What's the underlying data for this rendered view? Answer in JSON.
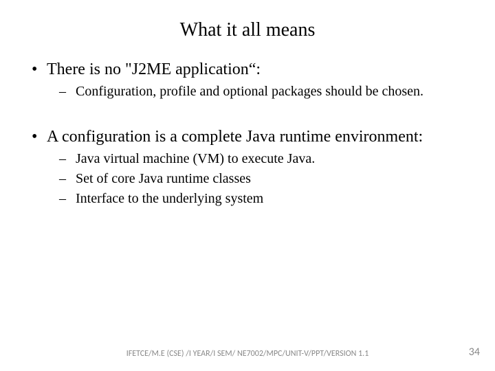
{
  "title": "What it all means",
  "bullets": [
    {
      "text": "There is no \"J2ME application“:",
      "sub": [
        "Configuration, profile and optional packages should be chosen."
      ]
    },
    {
      "text": "A configuration is a complete Java runtime environment:",
      "sub": [
        "Java virtual machine (VM) to execute Java.",
        "Set of core Java runtime classes",
        "Interface to the underlying system"
      ]
    }
  ],
  "footer": "IFETCE/M.E (CSE) /I YEAR/I SEM/ NE7002/MPC/UNIT-V/PPT/VERSION 1.1",
  "page_number": "34"
}
